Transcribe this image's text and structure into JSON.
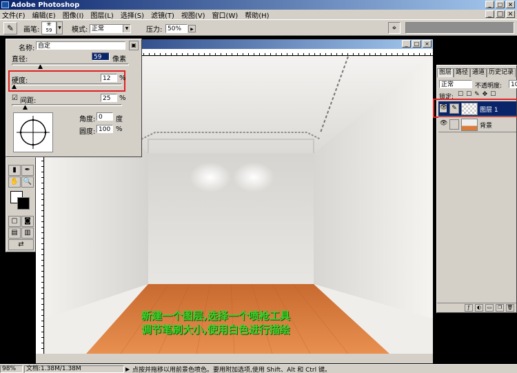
{
  "app": {
    "title": "Adobe Photoshop"
  },
  "window_buttons": [
    "_",
    "□",
    "×"
  ],
  "menu": [
    "文件(F)",
    "编辑(E)",
    "图像(I)",
    "图层(L)",
    "选择(S)",
    "滤镜(T)",
    "视图(V)",
    "窗口(W)",
    "帮助(H)"
  ],
  "options": {
    "brush_label": "画笔:",
    "brush_size": "59",
    "mode_label": "模式:",
    "mode_value": "正常",
    "pressure_label": "压力:",
    "pressure_value": "50%"
  },
  "brush_panel": {
    "name_label": "名称:",
    "name_value": "自定",
    "diameter_label": "直径:",
    "diameter_value": "59",
    "diameter_unit": "像素",
    "diameter_level": 0.24,
    "hardness_label": "硬度:",
    "hardness_value": "12",
    "hardness_unit": "%",
    "hardness_level": 0.02,
    "spacing_label": "间距:",
    "spacing_value": "25",
    "spacing_unit": "%",
    "spacing_level": 0.12,
    "angle_label": "角度:",
    "angle_value": "0",
    "angle_unit": "度",
    "roundness_label": "圆度:",
    "roundness_value": "100",
    "roundness_unit": "%"
  },
  "layers_panel": {
    "tabs": [
      "图层",
      "路径",
      "通道",
      "历史记录"
    ],
    "blend_mode": "正常",
    "opacity_label": "不透明度:",
    "opacity_value": "10",
    "lock_label": "锁定:",
    "layers": [
      {
        "name": "图层 1",
        "selected": true
      },
      {
        "name": "背景",
        "selected": false
      }
    ]
  },
  "status": {
    "zoom": "98%",
    "doc_info": "文档:1.38M/1.38M",
    "hint": "点按并拖移以用前景色喷色。要用附加选项,使用 Shift、Alt 和 Ctrl 键。"
  },
  "caption": {
    "line1": "新建一个图层,选择一个喷枪工具",
    "line2": "调节笔刷大小,使用白色进行描绘"
  },
  "colors": {
    "highlight": "#e02020",
    "caption": "#3fd12a",
    "title_bar": "#0a246a",
    "floor": "#d97c3c"
  }
}
